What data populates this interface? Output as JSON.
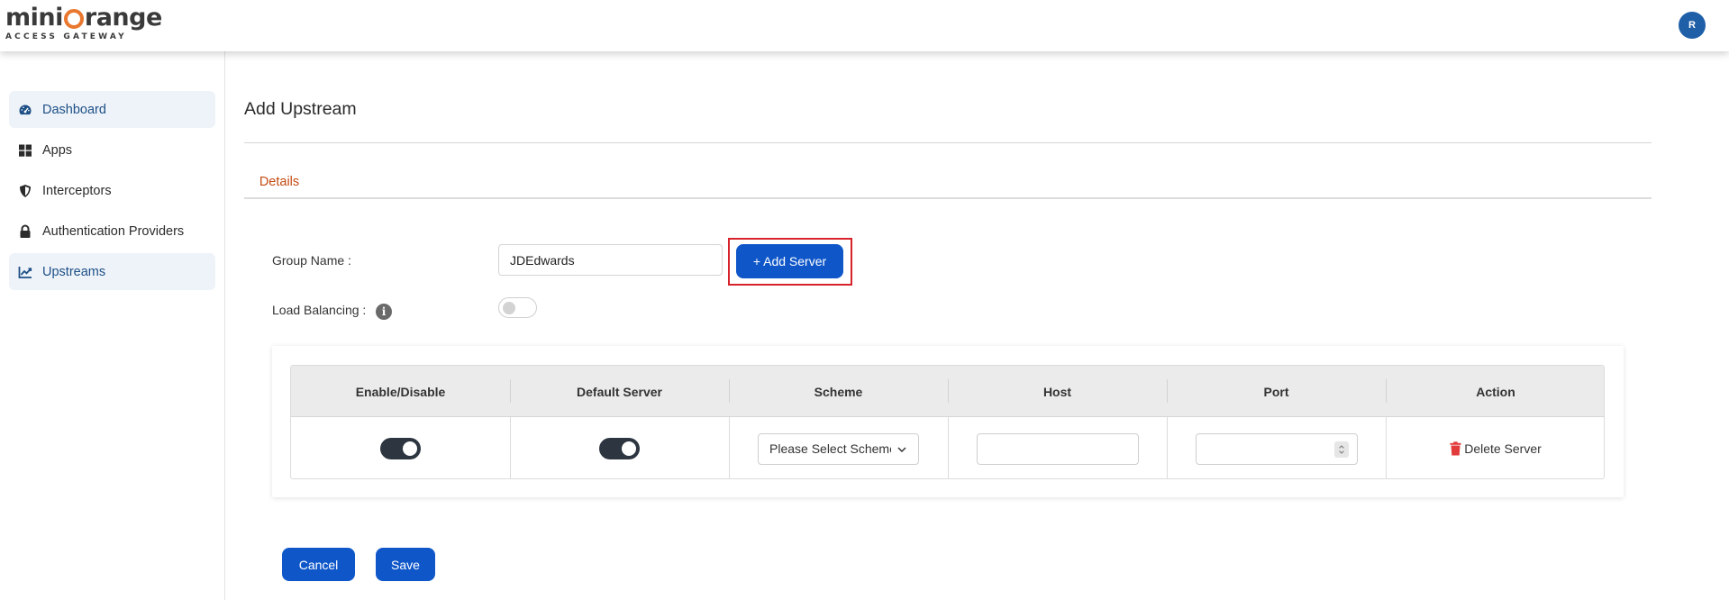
{
  "brand": {
    "logo_main_a": "mini",
    "logo_main_b": "range",
    "logo_sub": "ACCESS GATEWAY",
    "accent": "#e9772e"
  },
  "user": {
    "avatar_initial": "R"
  },
  "sidebar": {
    "items": [
      {
        "label": "Dashboard",
        "icon": "dashboard-gauge-icon",
        "active": true
      },
      {
        "label": "Apps",
        "icon": "apps-grid-icon"
      },
      {
        "label": "Interceptors",
        "icon": "shield-icon"
      },
      {
        "label": "Authentication Providers",
        "icon": "lock-icon"
      },
      {
        "label": "Upstreams",
        "icon": "chart-line-icon",
        "active": true
      }
    ]
  },
  "page": {
    "title": "Add Upstream",
    "tabs": [
      {
        "label": "Details",
        "active": true
      }
    ]
  },
  "form": {
    "group_name_label": "Group Name :",
    "group_name_value": "JDEdwards",
    "add_server_label": "+ Add Server",
    "load_balancing_label": "Load Balancing :",
    "load_balancing_enabled": false,
    "info_glyph": "i"
  },
  "servers_table": {
    "columns": [
      "Enable/Disable",
      "Default Server",
      "Scheme",
      "Host",
      "Port",
      "Action"
    ],
    "rows": [
      {
        "enabled": true,
        "default_server": true,
        "scheme_placeholder": "Please Select Scheme",
        "host": "",
        "port": "",
        "action_label": "Delete Server"
      }
    ]
  },
  "actions": {
    "cancel_label": "Cancel",
    "save_label": "Save"
  },
  "colors": {
    "primary": "#0f57c9",
    "tab_active": "#e0651f",
    "highlight": "#d6232c",
    "delete": "#e23b3b"
  }
}
